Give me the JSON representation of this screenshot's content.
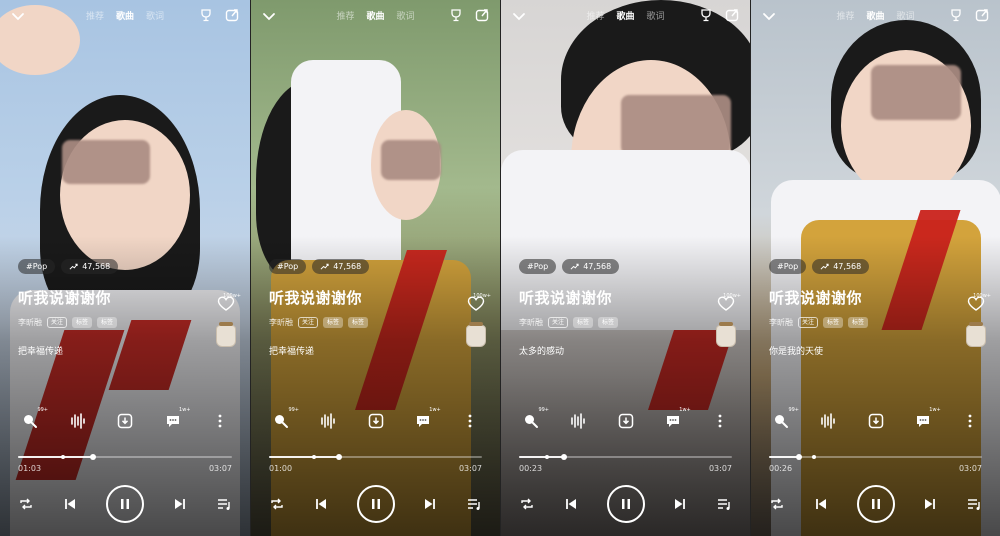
{
  "tabs": [
    "推荐",
    "歌曲",
    "歌词"
  ],
  "active_tab": "歌曲",
  "panels": [
    {
      "genre_tag": "#Pop",
      "play_count": "47,568",
      "song_title": "听我说谢谢你",
      "artist": "李昕融",
      "follow_label": "关注",
      "badge_1": "标签",
      "badge_2": "标签",
      "lyric": "把幸福传递",
      "likes": "100w+",
      "comment_count": "99+",
      "share_count": "1w+",
      "current_time": "01:03",
      "total_time": "03:07",
      "progress": 0.35,
      "buffer": 0.21
    },
    {
      "genre_tag": "#Pop",
      "play_count": "47,568",
      "song_title": "听我说谢谢你",
      "artist": "李昕融",
      "follow_label": "关注",
      "badge_1": "标签",
      "badge_2": "标签",
      "lyric": "把幸福传递",
      "likes": "100w+",
      "comment_count": "99+",
      "share_count": "1w+",
      "current_time": "01:00",
      "total_time": "03:07",
      "progress": 0.33,
      "buffer": 0.21
    },
    {
      "genre_tag": "#Pop",
      "play_count": "47,568",
      "song_title": "听我说谢谢你",
      "artist": "李昕融",
      "follow_label": "关注",
      "badge_1": "标签",
      "badge_2": "标签",
      "lyric": "太多的感动",
      "likes": "100w+",
      "comment_count": "99+",
      "share_count": "1w+",
      "current_time": "00:23",
      "total_time": "03:07",
      "progress": 0.21,
      "buffer": 0.13
    },
    {
      "genre_tag": "#Pop",
      "play_count": "47,568",
      "song_title": "听我说谢谢你",
      "artist": "李昕融",
      "follow_label": "关注",
      "badge_1": "标签",
      "badge_2": "标签",
      "lyric": "你是我的天使",
      "likes": "100w+",
      "comment_count": "99+",
      "share_count": "1w+",
      "current_time": "00:26",
      "total_time": "03:07",
      "progress": 0.14,
      "buffer": 0.21
    }
  ],
  "icons": {
    "collapse": "chevron-down-icon",
    "trophy": "trophy-icon",
    "share": "share-out-icon",
    "trend": "trend-icon",
    "heart": "heart-icon",
    "search_voice": "search-icon",
    "equalizer": "equalizer-icon",
    "download": "download-icon",
    "comment": "comment-icon",
    "more": "more-vertical-icon",
    "repeat": "repeat-icon",
    "prev": "previous-icon",
    "pause": "pause-icon",
    "next": "next-icon",
    "playlist": "playlist-icon"
  },
  "colors": {
    "accent": "#ffffff",
    "scarf": "#c9221b",
    "vest": "#d3a33c"
  }
}
